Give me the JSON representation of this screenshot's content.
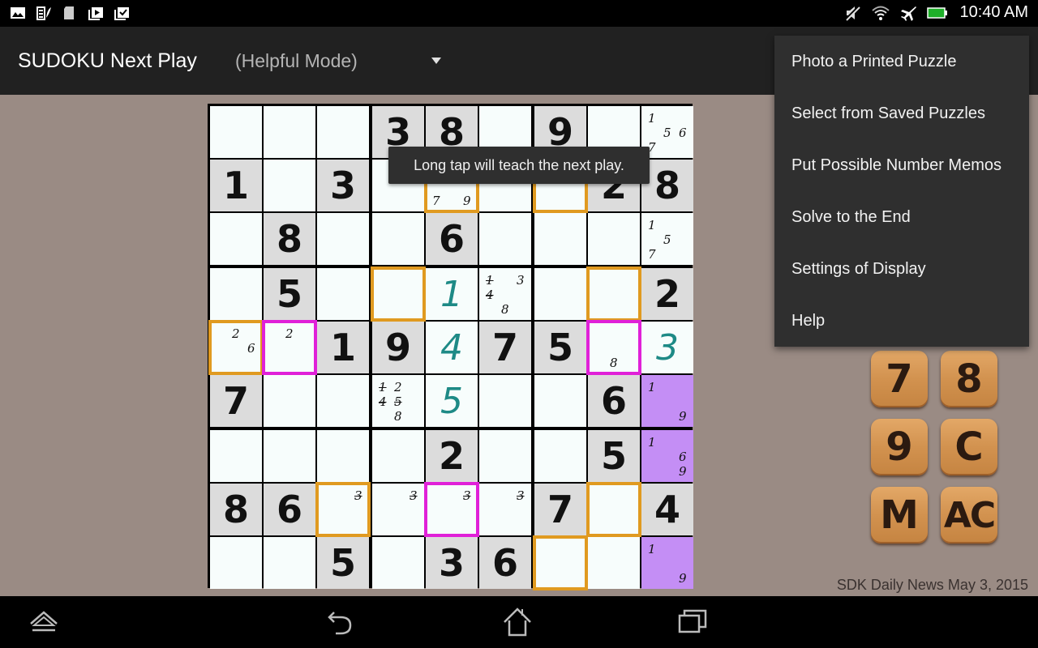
{
  "status_bar": {
    "left_icons": [
      "gallery-icon",
      "battery-saver-icon",
      "sd-card-icon",
      "play-store-update-icon",
      "download-done-icon"
    ],
    "right_icons": [
      "mute-icon",
      "wifi-icon",
      "airplane-mode-icon",
      "battery-icon"
    ],
    "time": "10:40 AM",
    "battery_color": "#1fb02a"
  },
  "action_bar": {
    "title": "SUDOKU Next Play",
    "mode": "(Helpful Mode)"
  },
  "toast": "Long tap will teach the next play.",
  "menu": {
    "items": [
      "Photo a Printed Puzzle",
      "Select from Saved Puzzles",
      "Put Possible Number Memos",
      "Solve to the End",
      "Settings of Display",
      "Help"
    ]
  },
  "keypad": {
    "keys": [
      "7",
      "8",
      "9",
      "C",
      "M",
      "AC"
    ]
  },
  "footer_note": "SDK Daily News May 3, 2015",
  "nav_bar": [
    "hide-bar-icon",
    "back-icon",
    "home-icon",
    "recent-apps-icon"
  ],
  "colors": {
    "given_bg": "#dcdcdc",
    "empty_bg": "#f7fdfc",
    "entered_digit": "#1e8a86",
    "highlight_orange": "#e09a20",
    "highlight_magenta": "#e020d8",
    "candidate_purple": "#c48ef5"
  },
  "board": {
    "rows": [
      [
        {
          "t": "e"
        },
        {
          "t": "e"
        },
        {
          "t": "e"
        },
        {
          "t": "g",
          "v": "3"
        },
        {
          "t": "g",
          "v": "8"
        },
        {
          "t": "e"
        },
        {
          "t": "g",
          "v": "9"
        },
        {
          "t": "e"
        },
        {
          "t": "m",
          "memos": [
            "1",
            "5",
            "6",
            "7"
          ]
        }
      ],
      [
        {
          "t": "g",
          "v": "1"
        },
        {
          "t": "e"
        },
        {
          "t": "g",
          "v": "3"
        },
        {
          "t": "e"
        },
        {
          "t": "m",
          "memos": [
            "7",
            "9"
          ],
          "hl": "orange"
        },
        {
          "t": "e"
        },
        {
          "t": "e",
          "hl": "orange"
        },
        {
          "t": "g",
          "v": "2"
        },
        {
          "t": "g",
          "v": "8"
        }
      ],
      [
        {
          "t": "e"
        },
        {
          "t": "g",
          "v": "8"
        },
        {
          "t": "e"
        },
        {
          "t": "e"
        },
        {
          "t": "g",
          "v": "6"
        },
        {
          "t": "e"
        },
        {
          "t": "e"
        },
        {
          "t": "e"
        },
        {
          "t": "m",
          "memos": [
            "1",
            "5",
            "7"
          ]
        }
      ],
      [
        {
          "t": "e"
        },
        {
          "t": "g",
          "v": "5"
        },
        {
          "t": "e"
        },
        {
          "t": "e",
          "hl": "orange"
        },
        {
          "t": "u",
          "v": "1"
        },
        {
          "t": "m",
          "memos": [
            "1",
            "3",
            "4",
            "8"
          ],
          "struck": [
            "1",
            "4"
          ]
        },
        {
          "t": "e"
        },
        {
          "t": "e",
          "hl": "orange"
        },
        {
          "t": "g",
          "v": "2"
        }
      ],
      [
        {
          "t": "m",
          "memos": [
            "2",
            "6"
          ],
          "hl": "orange"
        },
        {
          "t": "m",
          "memos": [
            "2"
          ],
          "hl": "magenta"
        },
        {
          "t": "g",
          "v": "1"
        },
        {
          "t": "g",
          "v": "9"
        },
        {
          "t": "u",
          "v": "4"
        },
        {
          "t": "g",
          "v": "7"
        },
        {
          "t": "g",
          "v": "5"
        },
        {
          "t": "m",
          "memos": [
            "8"
          ],
          "hl": "magenta"
        },
        {
          "t": "u",
          "v": "3"
        }
      ],
      [
        {
          "t": "g",
          "v": "7"
        },
        {
          "t": "e"
        },
        {
          "t": "e"
        },
        {
          "t": "m",
          "memos": [
            "1",
            "2",
            "4",
            "5",
            "8"
          ],
          "struck": [
            "1",
            "4",
            "5"
          ]
        },
        {
          "t": "u",
          "v": "5"
        },
        {
          "t": "e"
        },
        {
          "t": "e"
        },
        {
          "t": "g",
          "v": "6"
        },
        {
          "t": "m",
          "memos": [
            "1",
            "9"
          ],
          "purple": true
        }
      ],
      [
        {
          "t": "e"
        },
        {
          "t": "e"
        },
        {
          "t": "e"
        },
        {
          "t": "e"
        },
        {
          "t": "g",
          "v": "2"
        },
        {
          "t": "e"
        },
        {
          "t": "e"
        },
        {
          "t": "g",
          "v": "5"
        },
        {
          "t": "m",
          "memos": [
            "1",
            "6",
            "9"
          ],
          "purple": true
        }
      ],
      [
        {
          "t": "g",
          "v": "8"
        },
        {
          "t": "g",
          "v": "6"
        },
        {
          "t": "m",
          "memos": [
            "3"
          ],
          "struck": [
            "3"
          ],
          "hl": "orange"
        },
        {
          "t": "m",
          "memos": [
            "3"
          ],
          "struck": [
            "3"
          ]
        },
        {
          "t": "m",
          "memos": [
            "3"
          ],
          "struck": [
            "3"
          ],
          "hl": "magenta"
        },
        {
          "t": "m",
          "memos": [
            "3"
          ],
          "struck": [
            "3"
          ]
        },
        {
          "t": "g",
          "v": "7"
        },
        {
          "t": "e",
          "hl": "orange"
        },
        {
          "t": "g",
          "v": "4"
        }
      ],
      [
        {
          "t": "e"
        },
        {
          "t": "e"
        },
        {
          "t": "g",
          "v": "5"
        },
        {
          "t": "e"
        },
        {
          "t": "g",
          "v": "3"
        },
        {
          "t": "g",
          "v": "6"
        },
        {
          "t": "e",
          "hl": "orange"
        },
        {
          "t": "e"
        },
        {
          "t": "m",
          "memos": [
            "1",
            "9"
          ],
          "purple": true
        }
      ]
    ]
  }
}
